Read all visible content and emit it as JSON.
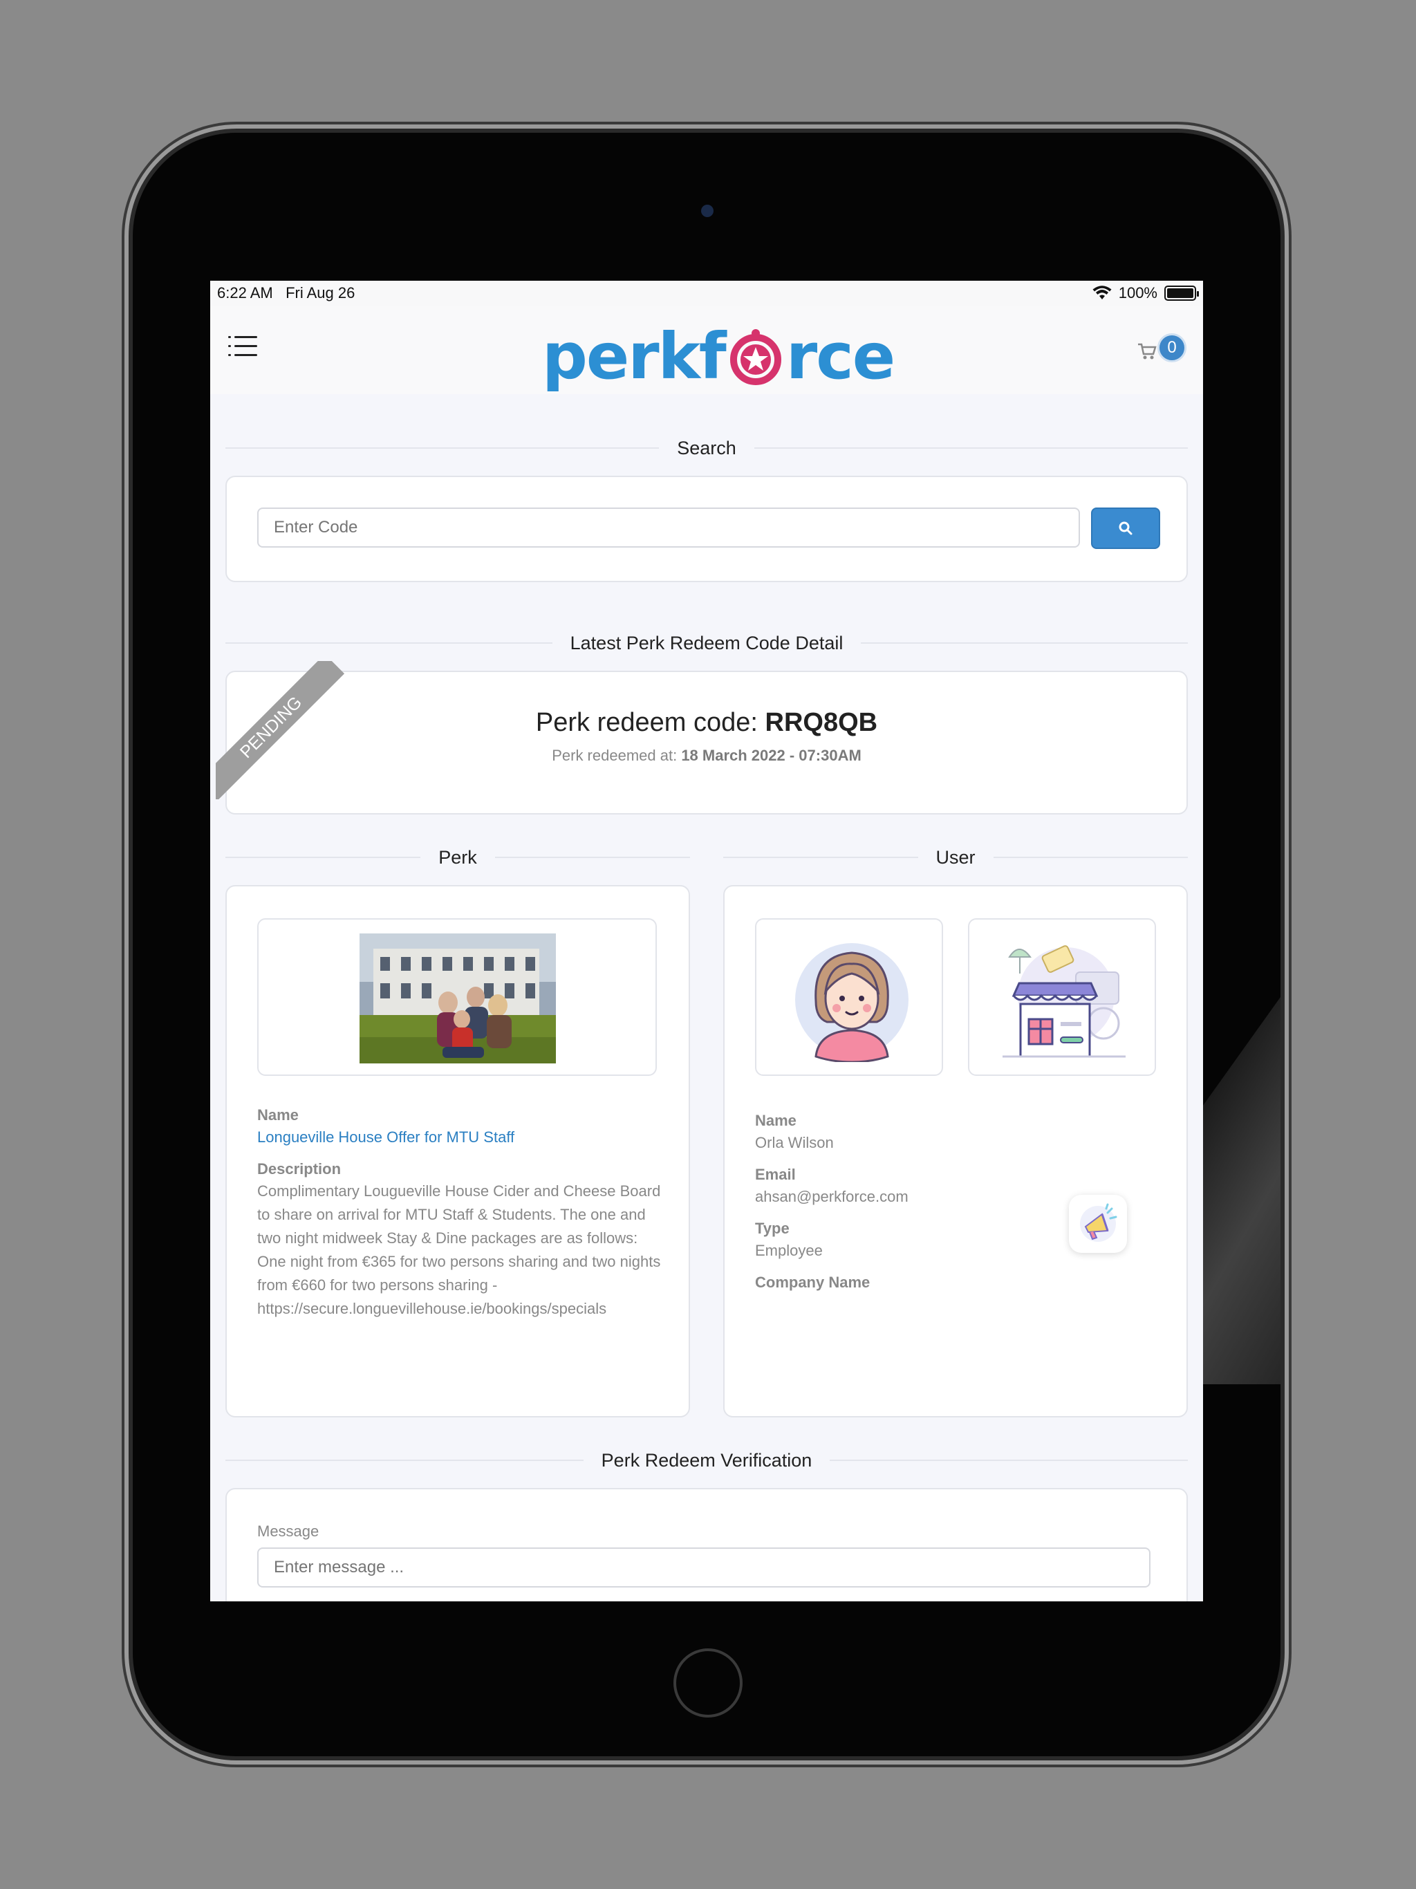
{
  "status_bar": {
    "time": "6:22 AM",
    "date": "Fri Aug 26",
    "battery": "100%"
  },
  "header": {
    "logo_left": "perkf",
    "logo_right": "rce",
    "cart_count": "0"
  },
  "search": {
    "heading": "Search",
    "placeholder": "Enter Code"
  },
  "latest": {
    "heading": "Latest Perk Redeem Code Detail",
    "status": "PENDING",
    "code_label": "Perk redeem code:",
    "code": "RRQ8QB",
    "redeemed_label": "Perk redeemed at:",
    "redeemed_at": "18 March 2022 - 07:30AM"
  },
  "perk": {
    "heading": "Perk",
    "name_label": "Name",
    "name": "Longueville House Offer for MTU Staff",
    "description_label": "Description",
    "description": "Complimentary Lougueville House Cider and Cheese Board to share on arrival for MTU Staff & Students. The one and two night midweek Stay & Dine packages are as follows: One night from €365 for two persons sharing and two nights from €660 for two persons sharing - https://secure.longuevillehouse.ie/bookings/specials"
  },
  "user": {
    "heading": "User",
    "name_label": "Name",
    "name": "Orla Wilson",
    "email_label": "Email",
    "email": "ahsan@perkforce.com",
    "type_label": "Type",
    "type": "Employee",
    "company_label": "Company Name"
  },
  "verification": {
    "heading": "Perk Redeem Verification",
    "message_label": "Message",
    "message_placeholder": "Enter message ..."
  },
  "colors": {
    "brand_blue": "#2c8fd3",
    "brand_pink": "#d6336c",
    "button_blue": "#3a8bd0",
    "badge_grey": "#9e9e9e"
  }
}
